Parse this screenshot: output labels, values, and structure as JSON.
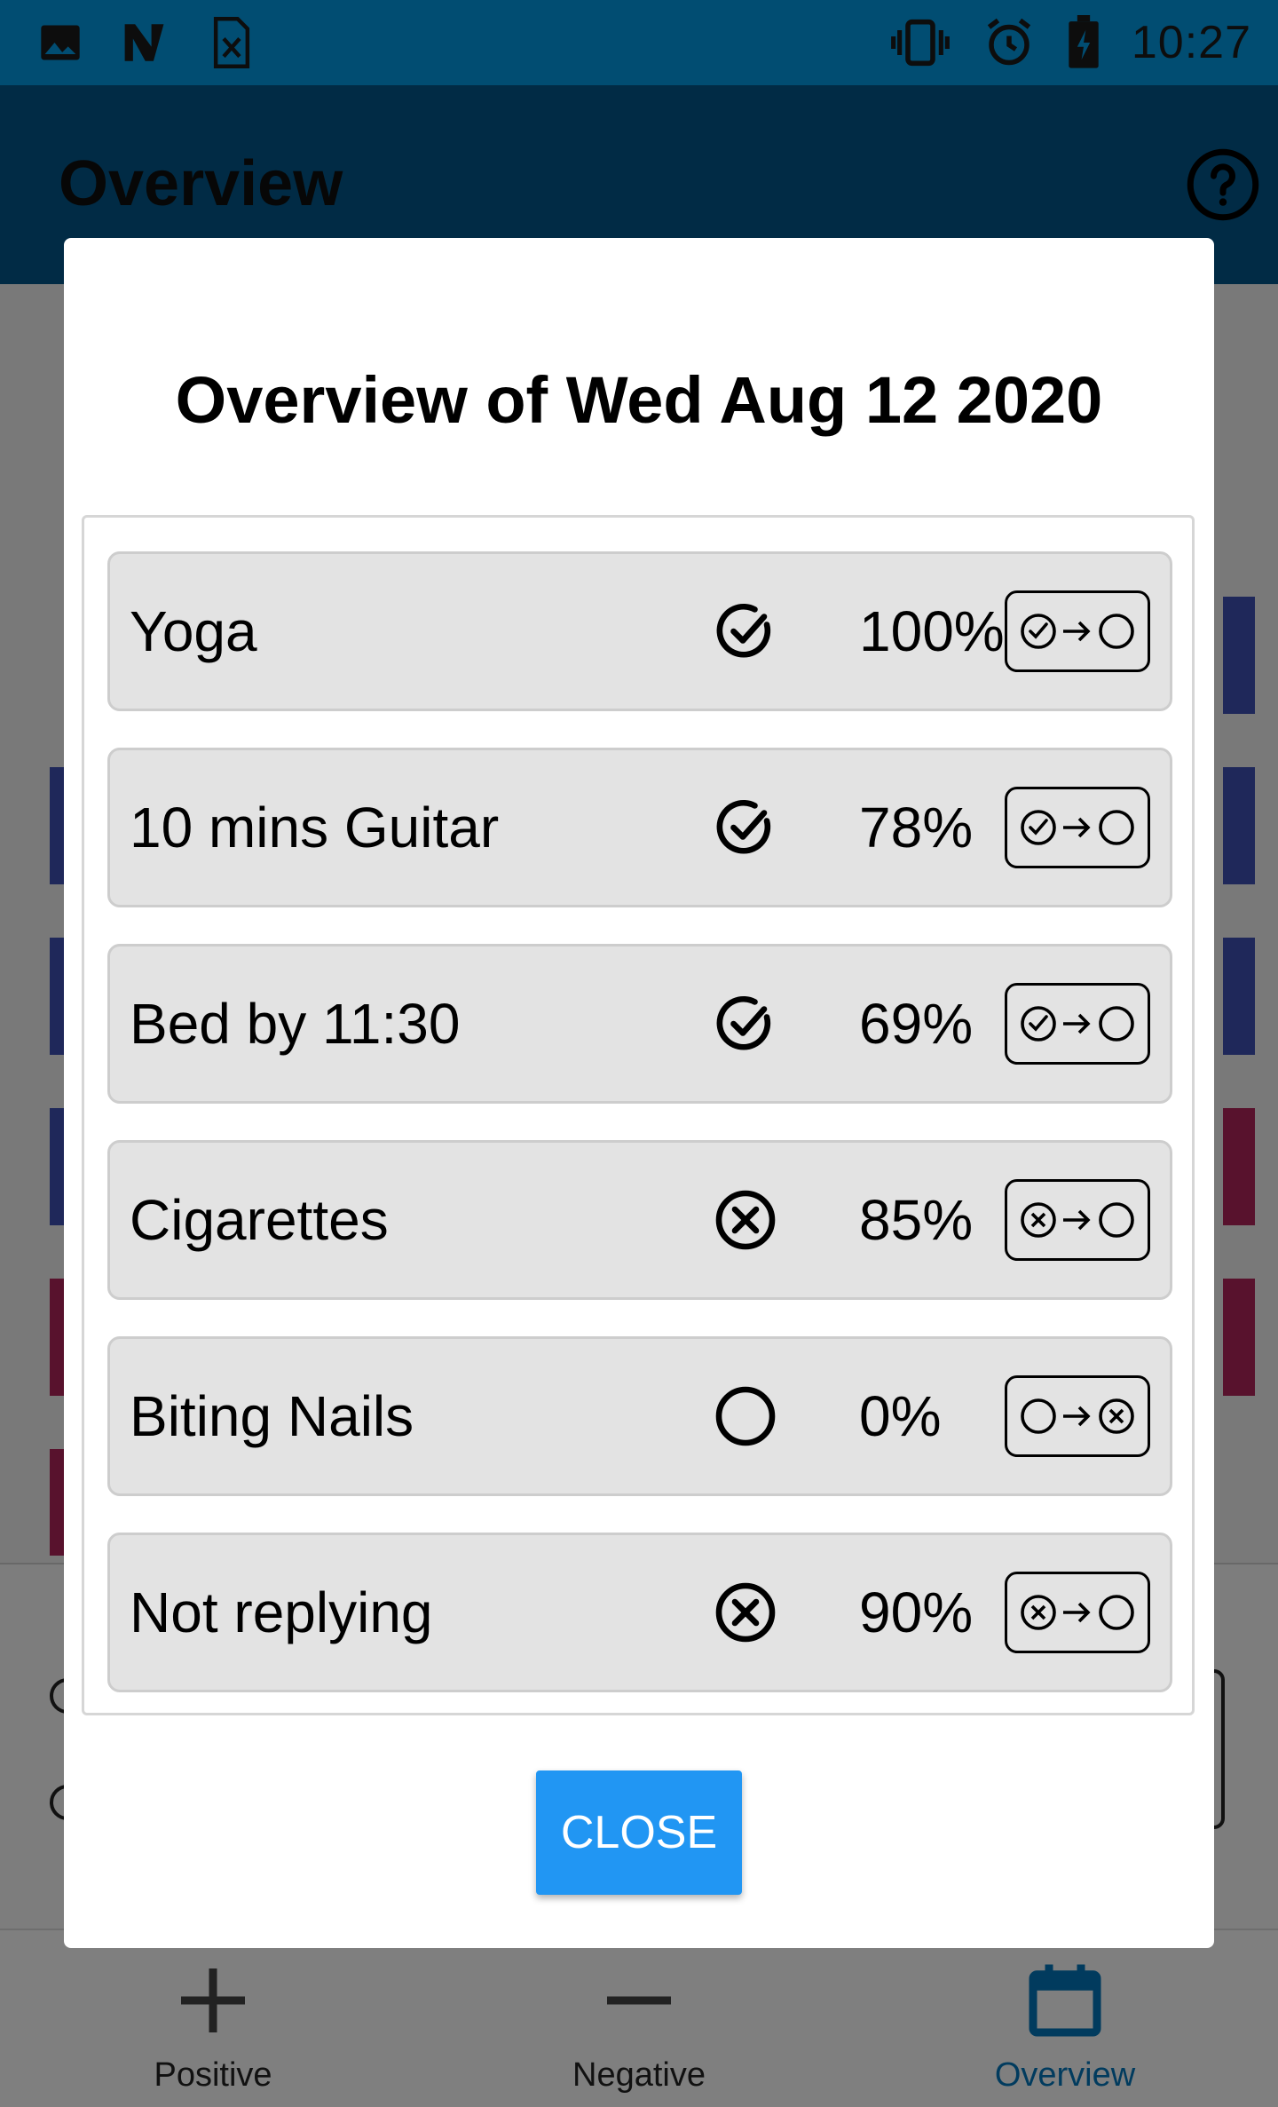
{
  "status_bar": {
    "time": "10:27",
    "left_icons": [
      "image-icon",
      "n-app-icon",
      "sheet-icon"
    ],
    "right_icons": [
      "vibrate-icon",
      "alarm-icon",
      "battery-charging-icon"
    ]
  },
  "app_bar": {
    "title": "Overview",
    "help_icon": "help-circle-icon"
  },
  "dialog": {
    "title": "Overview of Wed Aug 12 2020",
    "rows": [
      {
        "name": "Yoga",
        "status": "check",
        "percent": "100%",
        "toggle": "check-to-empty"
      },
      {
        "name": "10 mins Guitar",
        "status": "check",
        "percent": "78%",
        "toggle": "check-to-empty"
      },
      {
        "name": "Bed by 11:30",
        "status": "check",
        "percent": "69%",
        "toggle": "check-to-empty"
      },
      {
        "name": "Cigarettes",
        "status": "cross",
        "percent": "85%",
        "toggle": "cross-to-empty"
      },
      {
        "name": "Biting Nails",
        "status": "empty",
        "percent": "0%",
        "toggle": "empty-to-cross"
      },
      {
        "name": "Not replying",
        "status": "cross",
        "percent": "90%",
        "toggle": "cross-to-empty"
      }
    ],
    "close_label": "CLOSE"
  },
  "bottom_nav": {
    "items": [
      {
        "label": "Positive",
        "icon": "plus-icon"
      },
      {
        "label": "Negative",
        "icon": "minus-icon"
      },
      {
        "label": "Overview",
        "icon": "calendar-icon",
        "active": true
      }
    ]
  },
  "colors": {
    "status_bar": "#039be5",
    "app_bar": "#02578a",
    "accent": "#2196f3",
    "positive_strip": "#3f51b5",
    "negative_strip": "#b0245a"
  }
}
